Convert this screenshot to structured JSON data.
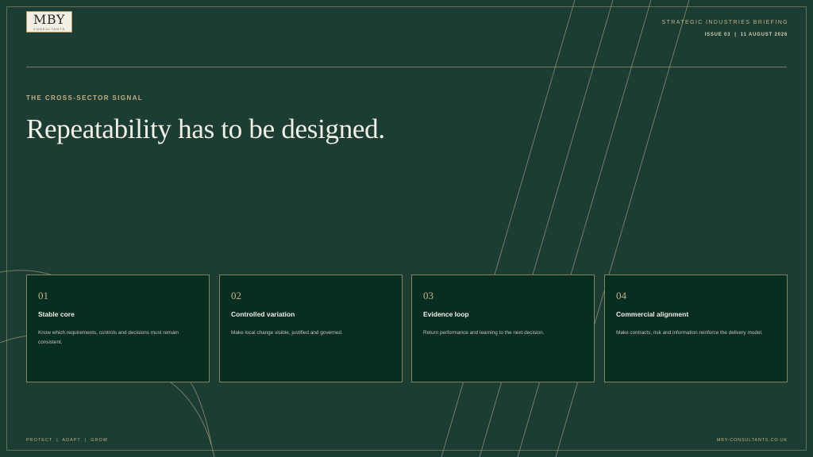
{
  "brand": {
    "logo_text": "MBY",
    "logo_sub": "CONSULTANTS"
  },
  "header": {
    "briefing": "STRATEGIC INDUSTRIES BRIEFING",
    "issue_line": "ISSUE 03  |  11 AUGUST 2026"
  },
  "main": {
    "eyebrow": "THE CROSS-SECTOR SIGNAL",
    "title": "Repeatability has to be designed."
  },
  "cards": [
    {
      "num": "01",
      "title": "Stable core",
      "body": "Know which requirements, controls and decisions must remain consistent."
    },
    {
      "num": "02",
      "title": "Controlled variation",
      "body": "Make local change visible, justified and governed."
    },
    {
      "num": "03",
      "title": "Evidence loop",
      "body": "Return performance and learning to the next decision."
    },
    {
      "num": "04",
      "title": "Commercial alignment",
      "body": "Make contracts, risk and information reinforce the delivery model."
    }
  ],
  "footer": {
    "tagline": "PROTECT  |  ADAPT  |  GROW",
    "website": "MBY-CONSULTANTS.CO.UK"
  },
  "colors": {
    "background": "#1b3d34",
    "card_background": "#082e24",
    "accent_gold": "#c4b083",
    "text_light": "#f3efe4"
  }
}
